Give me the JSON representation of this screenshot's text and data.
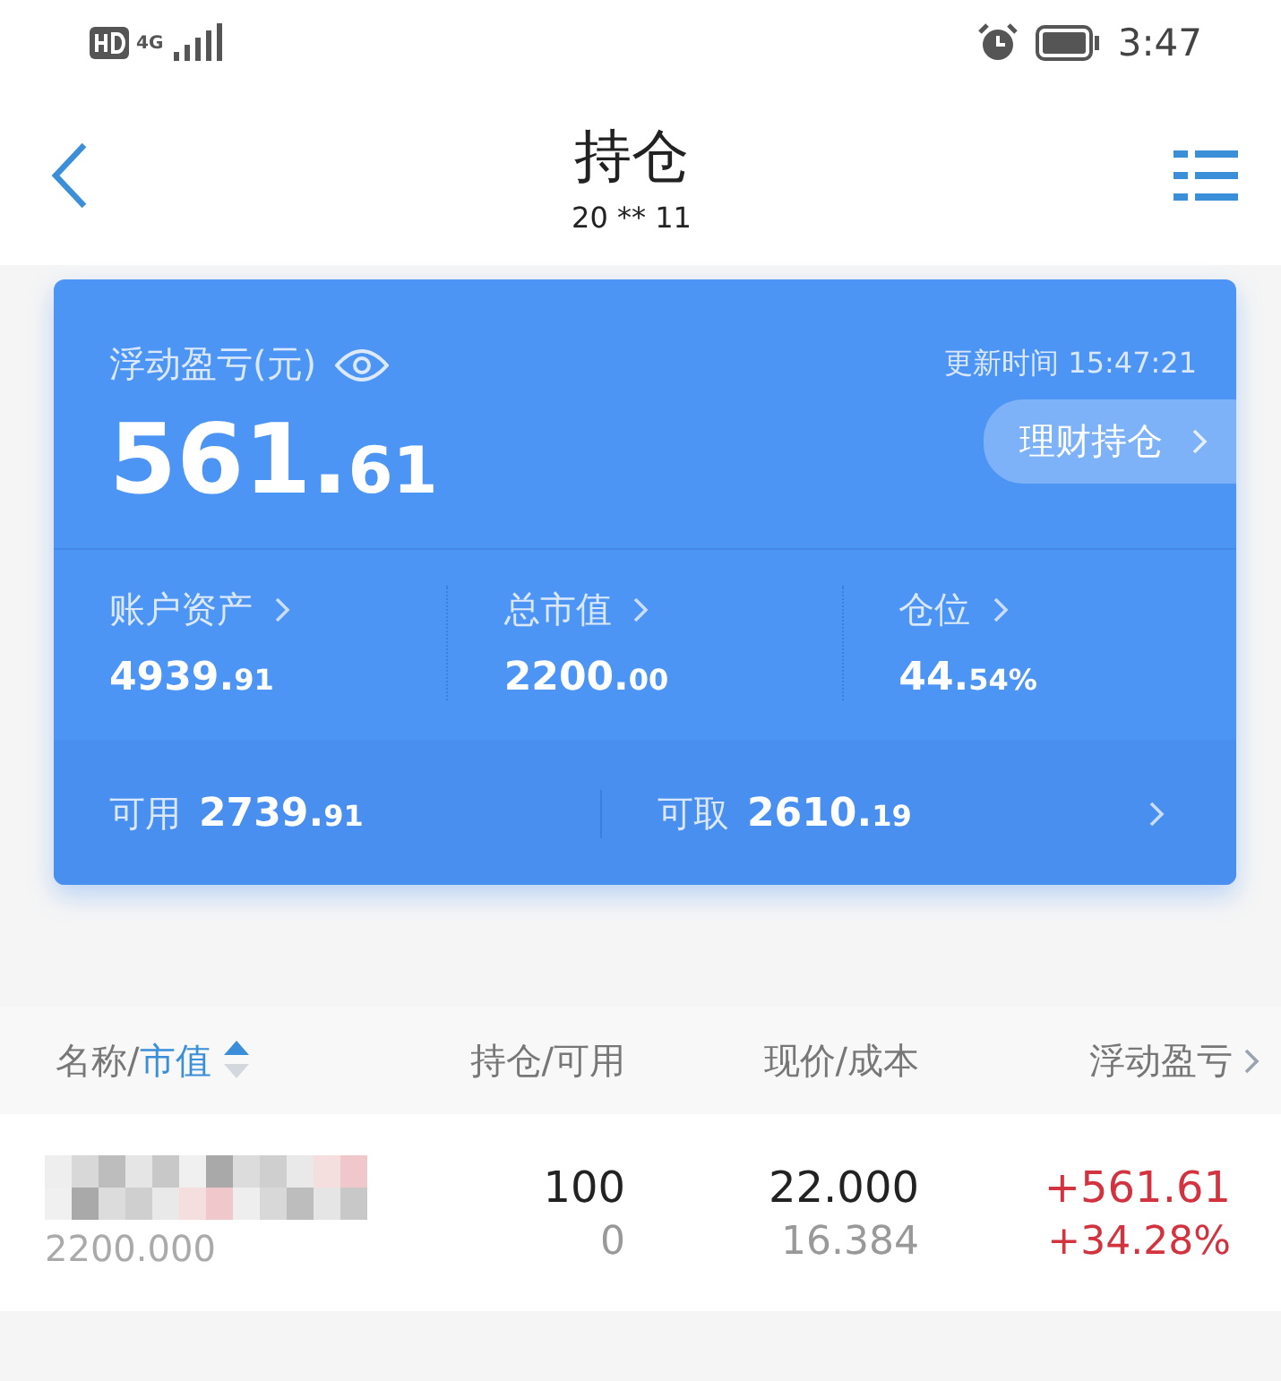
{
  "status_bar": {
    "network": "4G",
    "time": "3:47"
  },
  "header": {
    "title": "持仓",
    "subtitle": "20 ** 11"
  },
  "summary": {
    "label": "浮动盈亏(元)",
    "value": "561.61",
    "updated": "更新时间 15:47:21",
    "link": "理财持仓",
    "stats": [
      {
        "label": "账户资产",
        "value": "4939.91"
      },
      {
        "label": "总市值",
        "value": "2200.00"
      },
      {
        "label": "仓位",
        "value": "44.54%"
      }
    ],
    "funds": [
      {
        "label": "可用",
        "value": "2739.91"
      },
      {
        "label": "可取",
        "value": "2610.19"
      }
    ]
  },
  "table": {
    "columns": [
      {
        "label": "名称/",
        "sort_label": "市值",
        "sort_ascending": true
      },
      {
        "label": "持仓/可用"
      },
      {
        "label": "现价/成本"
      },
      {
        "label": "浮动盈亏"
      }
    ],
    "rows": [
      {
        "market_value": "2200.000",
        "holding": "100",
        "available": "0",
        "price": "22.000",
        "cost": "16.384",
        "pnl": "+561.61",
        "pnl_pct": "+34.28%",
        "gain": true
      }
    ]
  }
}
